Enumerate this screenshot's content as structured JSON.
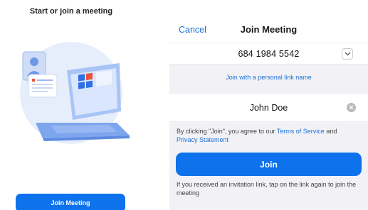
{
  "left": {
    "title": "Start or join a meeting",
    "join_button_label": "Join Meeting"
  },
  "nav": {
    "cancel_label": "Cancel",
    "title": "Join Meeting"
  },
  "meeting_id": {
    "value": "684 1984 5542"
  },
  "personal_link": {
    "label": "Join with a personal link name"
  },
  "name_field": {
    "value": "John Doe"
  },
  "terms": {
    "prefix": "By clicking \"Join\", you agree to our ",
    "terms_link": "Terms of Service",
    "middle": " and ",
    "privacy_link": "Privacy Statement"
  },
  "join_button": {
    "label": "Join"
  },
  "hint": {
    "text": "If you received an invitation link, tap on the link again to join the meeting"
  },
  "colors": {
    "accent": "#0e72ed",
    "link": "#1a6fd6",
    "band": "#f2f2f6"
  },
  "icons": [
    "illustration",
    "chevron-down-icon",
    "clear-icon"
  ]
}
